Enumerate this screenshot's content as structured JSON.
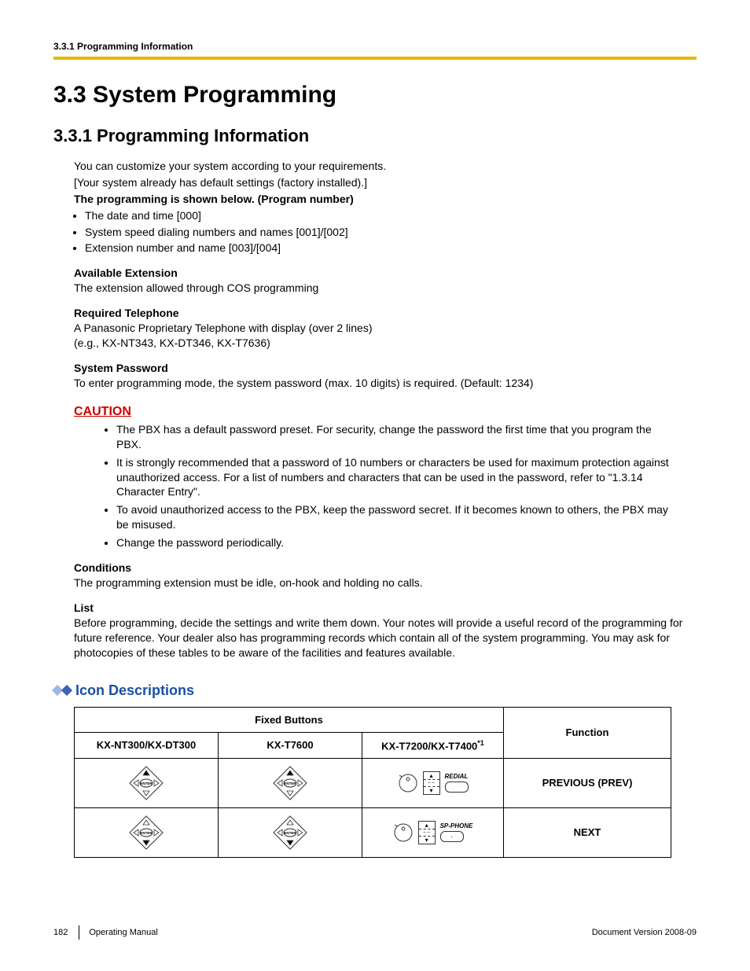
{
  "header": {
    "running": "3.3.1 Programming Information"
  },
  "h1": "3.3  System Programming",
  "h2": "3.3.1  Programming Information",
  "intro": {
    "p1": "You can customize your system according to your requirements.",
    "p2": "[Your system already has default settings (factory installed).]",
    "p3": "The programming is shown below. (Program number)",
    "bullets": [
      "The date and time [000]",
      "System speed dialing numbers and names [001]/[002]",
      "Extension number and name [003]/[004]"
    ]
  },
  "avail_ext": {
    "h": "Available Extension",
    "p": "The extension allowed through COS programming"
  },
  "req_tel": {
    "h": "Required Telephone",
    "p1": "A Panasonic Proprietary Telephone with display (over 2 lines)",
    "p2": "(e.g., KX-NT343, KX-DT346, KX-T7636)"
  },
  "sys_pwd": {
    "h": "System Password",
    "p": "To enter programming mode, the system password (max. 10 digits) is required. (Default: 1234)"
  },
  "caution": {
    "h": "CAUTION",
    "bullets": [
      "The PBX has a default password preset. For security, change the password the first time that you program the PBX.",
      "It is strongly recommended that a password of 10 numbers or characters be used for maximum protection against unauthorized access. For a list of numbers and characters that can be used in the password, refer to \"1.3.14  Character Entry\".",
      "To avoid unauthorized access to the PBX, keep the password secret. If it becomes known to others, the PBX may be misused.",
      "Change the password periodically."
    ]
  },
  "conditions": {
    "h": "Conditions",
    "p": "The programming extension must be idle, on-hook and holding no calls."
  },
  "list": {
    "h": "List",
    "p": "Before programming, decide the settings and write them down. Your notes will provide a useful record of the programming for future reference. Your dealer also has programming records which contain all of the system programming. You may ask for photocopies of these tables to be aware of the facilities and features available."
  },
  "icon_desc": {
    "h": "Icon Descriptions"
  },
  "table": {
    "fixed_buttons": "Fixed Buttons",
    "function": "Function",
    "cols": [
      "KX-NT300/KX-DT300",
      "KX-T7600",
      "KX-T7200/KX-T7400"
    ],
    "col3_note": "*1",
    "rows": [
      {
        "c3_label": "REDIAL",
        "c3_btn": "",
        "fn": "PREVIOUS (PREV)"
      },
      {
        "c3_label": "SP-PHONE",
        "c3_btn": "·",
        "fn": "NEXT"
      }
    ],
    "nav_label": "ENTER"
  },
  "footer": {
    "page": "182",
    "manual": "Operating Manual",
    "version": "Document Version  2008-09"
  }
}
